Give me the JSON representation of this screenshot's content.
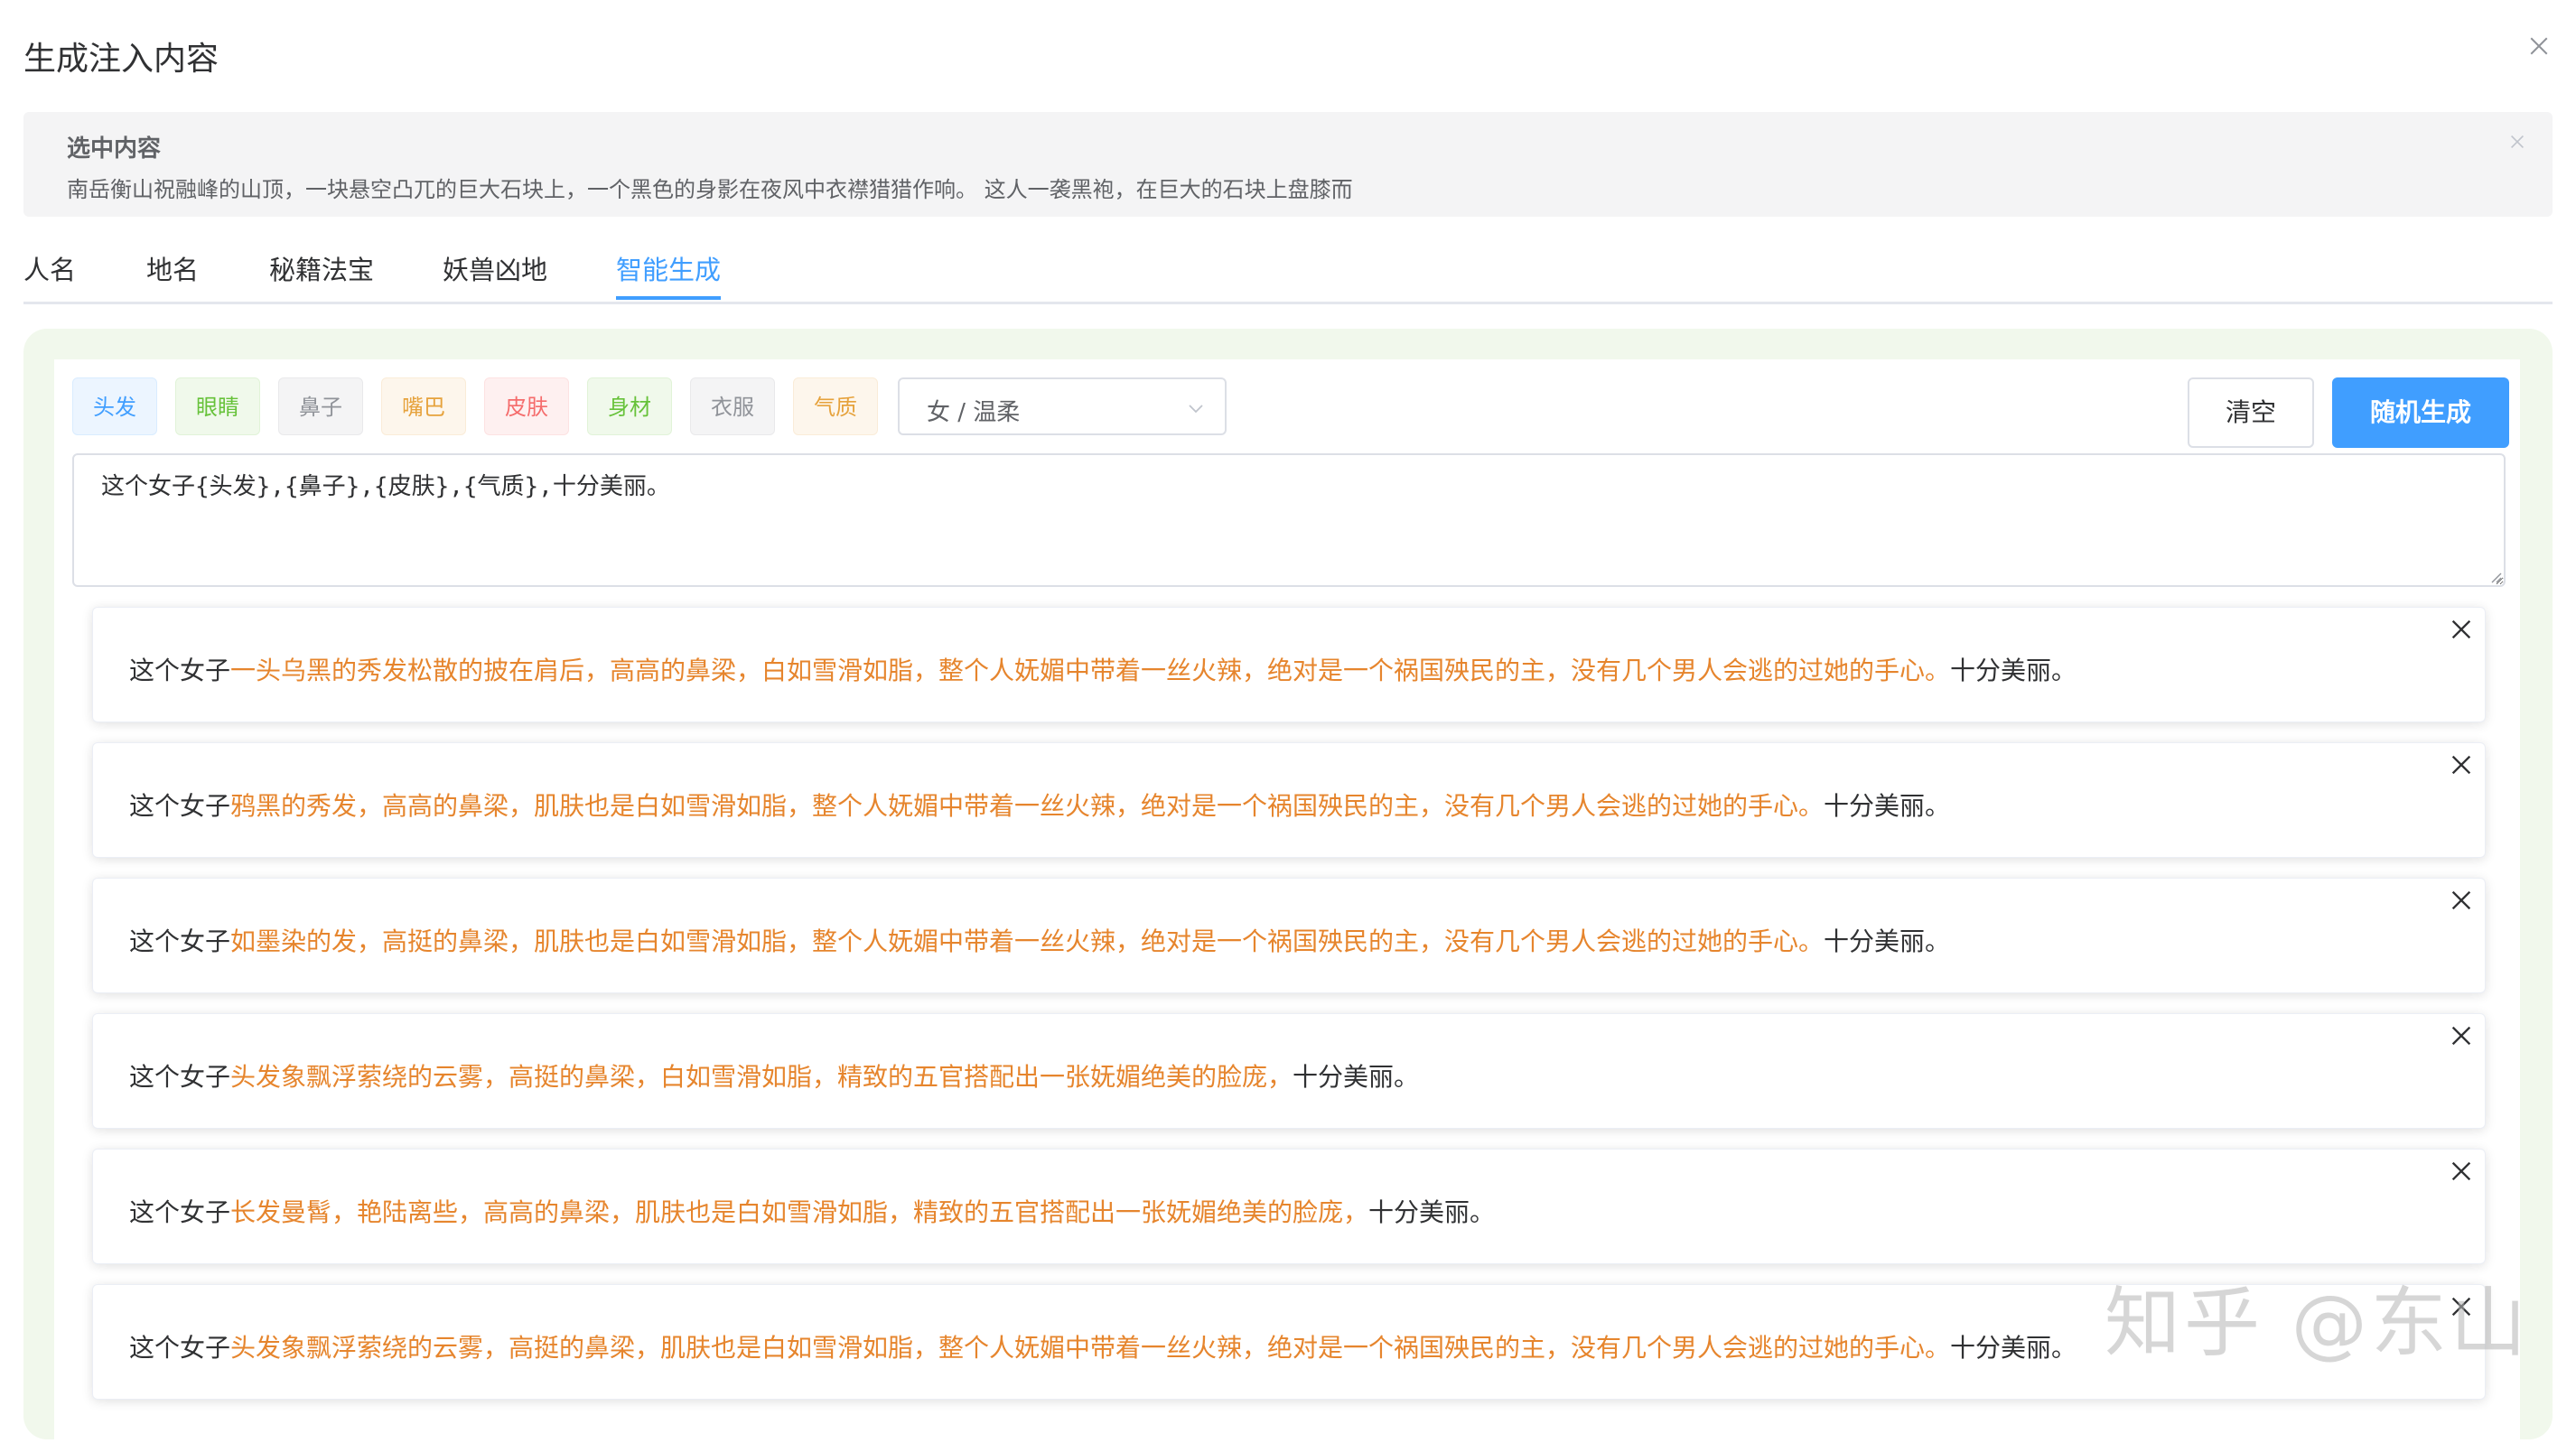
{
  "dialog": {
    "title": "生成注入内容",
    "close_icon": "close-icon"
  },
  "selected": {
    "title": "选中内容",
    "text": "南岳衡山祝融峰的山顶，一块悬空凸兀的巨大石块上，一个黑色的身影在夜风中衣襟猎猎作响。 这人一袭黑袍，在巨大的石块上盘膝而"
  },
  "tabs": [
    {
      "label": "人名"
    },
    {
      "label": "地名"
    },
    {
      "label": "秘籍法宝"
    },
    {
      "label": "妖兽凶地"
    },
    {
      "label": "智能生成",
      "active": true
    }
  ],
  "tags": [
    {
      "label": "头发",
      "color": "blue"
    },
    {
      "label": "眼睛",
      "color": "green"
    },
    {
      "label": "鼻子",
      "color": "gray"
    },
    {
      "label": "嘴巴",
      "color": "orange"
    },
    {
      "label": "皮肤",
      "color": "red"
    },
    {
      "label": "身材",
      "color": "green"
    },
    {
      "label": "衣服",
      "color": "gray"
    },
    {
      "label": "气质",
      "color": "orange"
    }
  ],
  "style_select": {
    "value": "女 / 温柔"
  },
  "buttons": {
    "clear": "清空",
    "random": "随机生成"
  },
  "template": {
    "value": "这个女子{头发},{鼻子},{皮肤},{气质},十分美丽。"
  },
  "results": [
    {
      "prefix": "这个女子",
      "mid": "一头乌黑的秀发松散的披在肩后，高高的鼻梁，白如雪滑如脂，整个人妩媚中带着一丝火辣，绝对是一个祸国殃民的主，没有几个男人会逃的过她的手心。",
      "suffix": "十分美丽。"
    },
    {
      "prefix": "这个女子",
      "mid": "鸦黑的秀发，高高的鼻梁，肌肤也是白如雪滑如脂，整个人妩媚中带着一丝火辣，绝对是一个祸国殃民的主，没有几个男人会逃的过她的手心。",
      "suffix": "十分美丽。"
    },
    {
      "prefix": "这个女子",
      "mid": "如墨染的发，高挺的鼻梁，肌肤也是白如雪滑如脂，整个人妩媚中带着一丝火辣，绝对是一个祸国殃民的主，没有几个男人会逃的过她的手心。",
      "suffix": "十分美丽。"
    },
    {
      "prefix": "这个女子",
      "mid": "头发象飘浮萦绕的云雾，高挺的鼻梁，白如雪滑如脂，精致的五官搭配出一张妩媚绝美的脸庞，",
      "suffix": "十分美丽。"
    },
    {
      "prefix": "这个女子",
      "mid": "长发曼髾，艳陆离些，高高的鼻梁，肌肤也是白如雪滑如脂，精致的五官搭配出一张妩媚绝美的脸庞，",
      "suffix": "十分美丽。"
    },
    {
      "prefix": "这个女子",
      "mid": "头发象飘浮萦绕的云雾，高挺的鼻梁，肌肤也是白如雪滑如脂，整个人妩媚中带着一丝火辣，绝对是一个祸国殃民的主，没有几个男人会逃的过她的手心。",
      "suffix": "十分美丽。"
    }
  ],
  "watermark": "知乎 @东山",
  "colors": {
    "accent": "#409eff",
    "result_highlight": "#e6852d",
    "panel_bg": "#f1f8ec"
  }
}
